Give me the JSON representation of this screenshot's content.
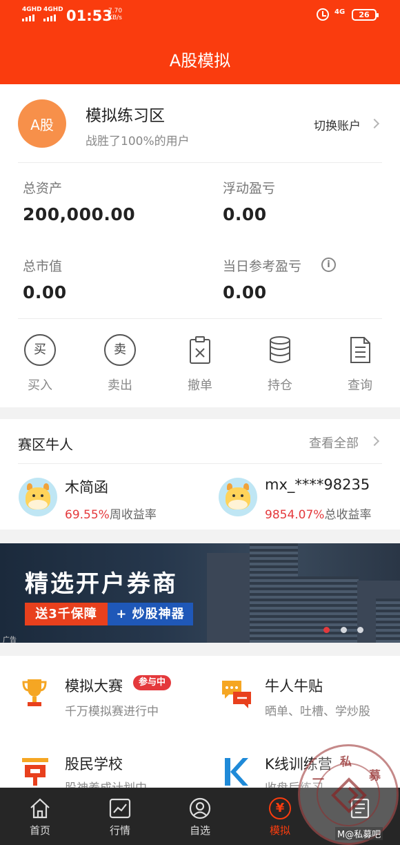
{
  "status_bar": {
    "net1": "4GHD",
    "net2": "4GHD",
    "time": "01:53",
    "speed_value": "7.70",
    "speed_unit": "KB/s",
    "net3": "4G",
    "battery": "26"
  },
  "header": {
    "title": "A股模拟"
  },
  "account": {
    "avatar_text": "A股",
    "name": "模拟练习区",
    "subtitle": "战胜了100%的用户",
    "switch_label": "切换账户"
  },
  "stats": {
    "total_assets_label": "总资产",
    "total_assets_value": "200,000.00",
    "floating_pl_label": "浮动盈亏",
    "floating_pl_value": "0.00",
    "market_value_label": "总市值",
    "market_value_value": "0.00",
    "daily_pl_label": "当日参考盈亏",
    "daily_pl_value": "0.00",
    "info_glyph": "i"
  },
  "actions": [
    {
      "label": "买入",
      "glyph": "买",
      "icon": "buy-icon"
    },
    {
      "label": "卖出",
      "glyph": "卖",
      "icon": "sell-icon"
    },
    {
      "label": "撤单",
      "icon": "cancel-order-icon"
    },
    {
      "label": "持仓",
      "icon": "holdings-icon"
    },
    {
      "label": "查询",
      "icon": "query-icon"
    }
  ],
  "bulls": {
    "title": "赛区牛人",
    "see_all": "查看全部",
    "users": [
      {
        "name": "木简函",
        "rate": "69.55%",
        "rate_label": "周收益率"
      },
      {
        "name": "mx_****98235",
        "rate": "9854.07%",
        "rate_label": "总收益率"
      }
    ]
  },
  "banner": {
    "title": "精选开户券商",
    "pill_red": "送3千保障",
    "pill_blue": "+ 炒股神器",
    "ad_tag": "广告",
    "active_dot": 1,
    "dot_count": 3
  },
  "features": [
    {
      "name": "模拟大赛",
      "badge": "参与中",
      "desc": "千万模拟赛进行中",
      "icon": "trophy-icon"
    },
    {
      "name": "牛人牛贴",
      "desc": "晒单、吐槽、学炒股",
      "icon": "chat-icon"
    },
    {
      "name": "股民学校",
      "desc": "股神养成计划中",
      "icon": "school-icon"
    },
    {
      "name": "K线训练营",
      "desc": "收盘后练习",
      "icon": "k-line-icon"
    }
  ],
  "watermark": {
    "t1": "一",
    "t2": "私",
    "t3": "募",
    "t4": "吧"
  },
  "tabs": [
    {
      "label": "首页",
      "icon": "home-icon"
    },
    {
      "label": "行情",
      "icon": "market-icon"
    },
    {
      "label": "自选",
      "icon": "watchlist-icon"
    },
    {
      "label": "模拟",
      "glyph": "¥",
      "icon": "simulate-icon"
    },
    {
      "label": "资讯",
      "icon": "news-icon"
    }
  ],
  "active_tab": "模拟",
  "credit": "M@私募吧",
  "colors": {
    "brand": "#fa3c0e",
    "gain": "#e4393c",
    "tabbar": "#262626"
  }
}
